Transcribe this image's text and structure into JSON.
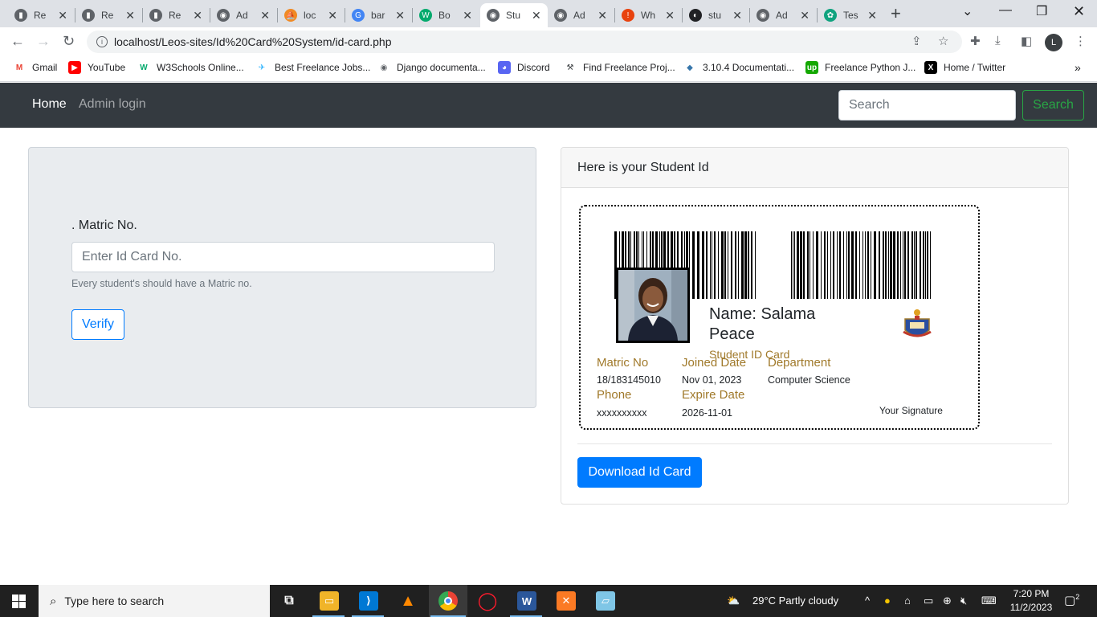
{
  "browser": {
    "tabs": [
      {
        "title": "Re",
        "icon": "page-icon",
        "color": "#5f6368"
      },
      {
        "title": "Re",
        "icon": "page-icon",
        "color": "#5f6368"
      },
      {
        "title": "Re",
        "icon": "page-icon",
        "color": "#5f6368"
      },
      {
        "title": "Ad",
        "icon": "globe-icon",
        "color": "#5f6368"
      },
      {
        "title": "loc",
        "icon": "phpmyadmin-icon",
        "color": "#f08a24"
      },
      {
        "title": "bar",
        "icon": "google-icon",
        "color": "#4285f4"
      },
      {
        "title": "Bo",
        "icon": "w3schools-icon",
        "color": "#04aa6d"
      },
      {
        "title": "Stu",
        "icon": "globe-icon",
        "color": "#5f6368"
      },
      {
        "title": "Ad",
        "icon": "globe-icon",
        "color": "#5f6368"
      },
      {
        "title": "Wh",
        "icon": "alert-icon",
        "color": "#e8430f"
      },
      {
        "title": "stu",
        "icon": "github-icon",
        "color": "#202124"
      },
      {
        "title": "Ad",
        "icon": "globe-icon",
        "color": "#5f6368"
      },
      {
        "title": "Tes",
        "icon": "chatgpt-icon",
        "color": "#10a37f"
      }
    ],
    "active_tab": 7,
    "url": "localhost/Leos-sites/Id%20Card%20System/id-card.php",
    "profile_initial": "L",
    "bookmarks": [
      {
        "label": "Gmail",
        "icon": "gmail-icon",
        "color": "#ea4335"
      },
      {
        "label": "YouTube",
        "icon": "youtube-icon",
        "color": "#ff0000"
      },
      {
        "label": "W3Schools Online...",
        "icon": "w3schools-icon",
        "color": "#04aa6d"
      },
      {
        "label": "Best Freelance Jobs...",
        "icon": "freelancer-icon",
        "color": "#29b2fe"
      },
      {
        "label": "Django documenta...",
        "icon": "globe-icon",
        "color": "#5f6368"
      },
      {
        "label": "Discord",
        "icon": "discord-icon",
        "color": "#5865f2"
      },
      {
        "label": "Find Freelance Proj...",
        "icon": "handshake-icon",
        "color": "#3c4043"
      },
      {
        "label": "3.10.4 Documentati...",
        "icon": "python-icon",
        "color": "#3776ab"
      },
      {
        "label": "Freelance Python J...",
        "icon": "upwork-icon",
        "color": "#14a800"
      },
      {
        "label": "Home / Twitter",
        "icon": "x-twitter-icon",
        "color": "#000000"
      }
    ]
  },
  "navbar": {
    "home": "Home",
    "admin": "Admin login",
    "search_placeholder": "Search",
    "search_button": "Search"
  },
  "form": {
    "label": ". Matric No.",
    "placeholder": "Enter Id Card No.",
    "help": "Every student's should have a Matric no.",
    "verify": "Verify"
  },
  "id_panel": {
    "header": "Here is your Student Id",
    "name_label": "Name: Salama Peace",
    "subtitle": "Student ID Card",
    "fields": {
      "matric_label": "Matric No",
      "matric_value": "18/183145010",
      "joined_label": "Joined Date",
      "joined_value": "Nov 01, 2023",
      "department_label": "Department",
      "department_value": "Computer Science",
      "phone_label": "Phone",
      "phone_value": "xxxxxxxxxx",
      "expire_label": "Expire Date",
      "expire_value": "2026-11-01"
    },
    "signature": "Your Signature",
    "download": "Download Id Card"
  },
  "taskbar": {
    "search_placeholder": "Type here to search",
    "weather": "29°C  Partly cloudy",
    "time": "7:20 PM",
    "date": "11/2/2023",
    "notifications": "2",
    "apps": [
      "task-view-icon",
      "file-explorer-icon",
      "vscode-icon",
      "vlc-icon",
      "chrome-icon",
      "opera-icon",
      "word-icon",
      "xampp-icon",
      "notepad-icon"
    ]
  },
  "colors": {
    "navbar_bg": "#343a40",
    "primary": "#007bff",
    "success": "#28a745",
    "card_label": "#a0792a"
  }
}
